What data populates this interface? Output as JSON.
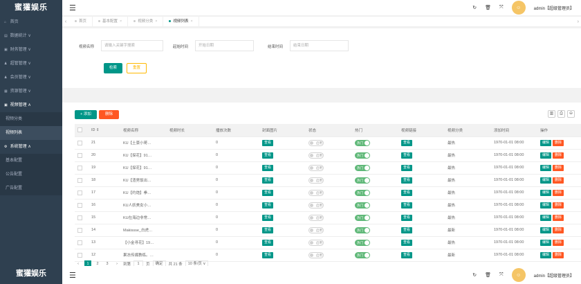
{
  "brand": "蜜獾娱乐",
  "sidebar": {
    "items": [
      {
        "label": "首页",
        "icon": "home-icon",
        "glyph": "⌂",
        "arrow": ""
      },
      {
        "label": "数据统计",
        "icon": "chart-icon",
        "glyph": "▤",
        "arrow": "∨"
      },
      {
        "label": "财务管理",
        "icon": "wallet-icon",
        "glyph": "▣",
        "arrow": "∨"
      },
      {
        "label": "超管管理",
        "icon": "user-icon",
        "glyph": "♟",
        "arrow": "∨"
      },
      {
        "label": "会员管理",
        "icon": "users-icon",
        "glyph": "♟",
        "arrow": "∨"
      },
      {
        "label": "资源管理",
        "icon": "folder-icon",
        "glyph": "▦",
        "arrow": "∨"
      }
    ],
    "video_group": {
      "label": "视频管理",
      "glyph": "▣",
      "arrow": "∧",
      "children": [
        "视频分类",
        "视频列表"
      ]
    },
    "system_group": {
      "label": "系统管理",
      "glyph": "⚙",
      "arrow": "∧",
      "children": [
        "基本配置",
        "公告配置",
        "广告配置"
      ]
    }
  },
  "header": {
    "user": "admin【超级管理员】",
    "avatar": "☺"
  },
  "tabs": {
    "prev": "‹",
    "next": "›",
    "close": "×",
    "items": [
      {
        "label": "首页",
        "active": false
      },
      {
        "label": "基本配置",
        "active": false
      },
      {
        "label": "视频分类",
        "active": false
      },
      {
        "label": "视频列表",
        "active": true
      }
    ]
  },
  "search": {
    "name_label": "视频名称",
    "name_placeholder": "请输入关键字搜索",
    "start_label": "起始时间",
    "start_placeholder": "开始日期",
    "end_label": "结束时间",
    "end_placeholder": "结束日期",
    "search_btn": "检索",
    "reset_btn": "重置"
  },
  "toolbar": {
    "add": "+ 添加",
    "delete": "删除"
  },
  "columns": [
    "ID ⇕",
    "视频名称",
    "视频时长",
    "播放次数",
    "封面图片",
    "状态",
    "热门",
    "视频链接",
    "视频分类",
    "添加时间",
    "操作"
  ],
  "labels": {
    "view": "查看",
    "status_off": "启用",
    "hot_on": "热门",
    "edit": "编辑",
    "del": "删除"
  },
  "rows": [
    {
      "id": "21",
      "name": "KU【土豪小哥…",
      "plays": "0",
      "category": "最热",
      "time": "1970-01-01 08:00"
    },
    {
      "id": "20",
      "name": "KU【探花】91…",
      "plays": "0",
      "category": "最热",
      "time": "1970-01-01 08:00"
    },
    {
      "id": "19",
      "name": "KU【探花】91…",
      "plays": "0",
      "category": "最热",
      "time": "1970-01-01 08:00"
    },
    {
      "id": "18",
      "name": "KU【渣男饭出…",
      "plays": "0",
      "category": "最热",
      "time": "1970-01-01 08:00"
    },
    {
      "id": "17",
      "name": "KU【约炮】拳…",
      "plays": "0",
      "category": "最热",
      "time": "1970-01-01 08:00"
    },
    {
      "id": "16",
      "name": "KU人妖美女小…",
      "plays": "0",
      "category": "最热",
      "time": "1970-01-01 08:00"
    },
    {
      "id": "15",
      "name": "KU在海边非常…",
      "plays": "0",
      "category": "最热",
      "time": "1970-01-01 08:00"
    },
    {
      "id": "14",
      "name": "Makissse_白虎…",
      "plays": "0",
      "category": "最新",
      "time": "1970-01-01 08:00"
    },
    {
      "id": "13",
      "name": "【小金寻花】19…",
      "plays": "0",
      "category": "最热",
      "time": "1970-01-01 08:00"
    },
    {
      "id": "12",
      "name": "果冻传媒教练。…",
      "plays": "0",
      "category": "最新",
      "time": "1970-01-01 08:00"
    }
  ],
  "pager": {
    "prev": "‹",
    "pages": [
      "1",
      "2",
      "3"
    ],
    "next": "›",
    "goto": "到第",
    "page_input": "1",
    "page_unit": "页",
    "confirm": "确定",
    "total": "共 21 条",
    "per_page": "10 条/页 ∨"
  },
  "colors": {
    "sidebar": "#2f4050",
    "primary": "#009688",
    "danger": "#ff5722",
    "warning": "#ffb800",
    "hot": "#5fb878"
  }
}
